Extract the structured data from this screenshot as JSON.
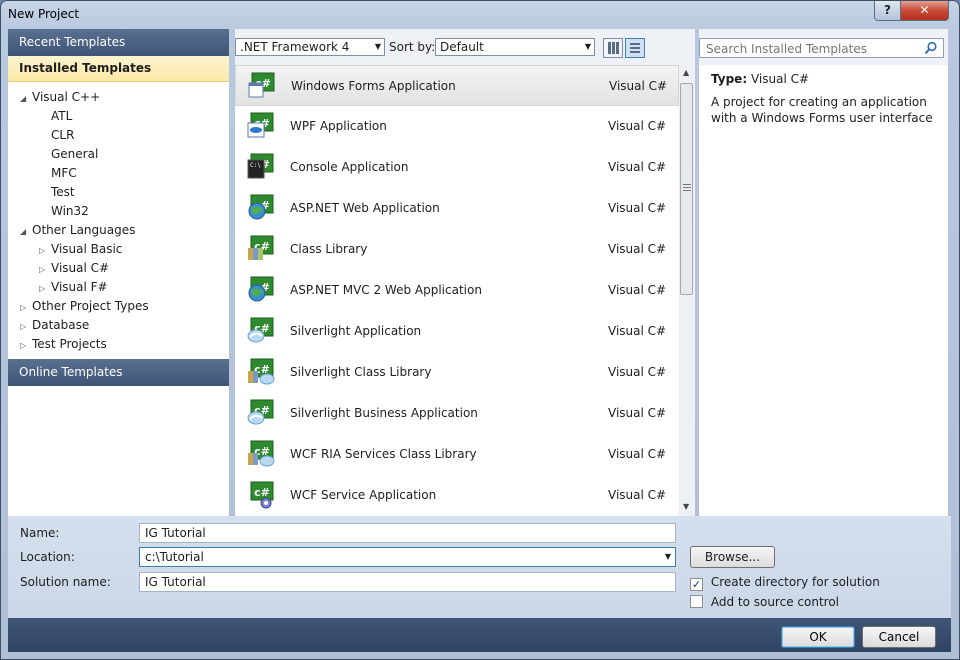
{
  "window": {
    "title": "New Project",
    "help_label": "?",
    "close_label": "✕"
  },
  "nav": {
    "recent": "Recent Templates",
    "installed": "Installed Templates",
    "online": "Online Templates",
    "tree": [
      {
        "label": "Visual C++",
        "arrow": "◢",
        "level": 0
      },
      {
        "label": "ATL",
        "arrow": "",
        "level": 1
      },
      {
        "label": "CLR",
        "arrow": "",
        "level": 1
      },
      {
        "label": "General",
        "arrow": "",
        "level": 1
      },
      {
        "label": "MFC",
        "arrow": "",
        "level": 1
      },
      {
        "label": "Test",
        "arrow": "",
        "level": 1
      },
      {
        "label": "Win32",
        "arrow": "",
        "level": 1
      },
      {
        "label": "Other Languages",
        "arrow": "◢",
        "level": 0
      },
      {
        "label": "Visual Basic",
        "arrow": "▷",
        "level": 1
      },
      {
        "label": "Visual C#",
        "arrow": "▷",
        "level": 1
      },
      {
        "label": "Visual F#",
        "arrow": "▷",
        "level": 1
      },
      {
        "label": "Other Project Types",
        "arrow": "▷",
        "level": 0
      },
      {
        "label": "Database",
        "arrow": "▷",
        "level": 0
      },
      {
        "label": "Test Projects",
        "arrow": "▷",
        "level": 0
      }
    ]
  },
  "toolbar": {
    "framework": ".NET Framework 4",
    "sort_label": "Sort by:",
    "sort_value": "Default"
  },
  "templates": [
    {
      "name": "Windows Forms Application",
      "lang": "Visual C#",
      "icon": "windows-forms-icon"
    },
    {
      "name": "WPF Application",
      "lang": "Visual C#",
      "icon": "wpf-icon"
    },
    {
      "name": "Console Application",
      "lang": "Visual C#",
      "icon": "console-icon"
    },
    {
      "name": "ASP.NET Web Application",
      "lang": "Visual C#",
      "icon": "web-globe-icon"
    },
    {
      "name": "Class Library",
      "lang": "Visual C#",
      "icon": "class-library-icon"
    },
    {
      "name": "ASP.NET MVC 2 Web Application",
      "lang": "Visual C#",
      "icon": "web-globe-icon"
    },
    {
      "name": "Silverlight Application",
      "lang": "Visual C#",
      "icon": "silverlight-icon"
    },
    {
      "name": "Silverlight Class Library",
      "lang": "Visual C#",
      "icon": "silverlight-library-icon"
    },
    {
      "name": "Silverlight Business Application",
      "lang": "Visual C#",
      "icon": "silverlight-icon"
    },
    {
      "name": "WCF RIA Services Class Library",
      "lang": "Visual C#",
      "icon": "silverlight-library-icon"
    },
    {
      "name": "WCF Service Application",
      "lang": "Visual C#",
      "icon": "wcf-service-icon"
    }
  ],
  "search": {
    "placeholder": "Search Installed Templates"
  },
  "description": {
    "type_label": "Type:",
    "type_value": "Visual C#",
    "text": "A project for creating an application with a Windows Forms user interface"
  },
  "form": {
    "name_label": "Name:",
    "name_value": "IG Tutorial",
    "location_label": "Location:",
    "location_value": "c:\\Tutorial",
    "solution_label": "Solution name:",
    "solution_value": "IG Tutorial",
    "browse_label": "Browse...",
    "create_dir_label": "Create directory for solution",
    "create_dir_checked": "✓",
    "source_control_label": "Add to source control"
  },
  "footer": {
    "ok_label": "OK",
    "cancel_label": "Cancel"
  }
}
